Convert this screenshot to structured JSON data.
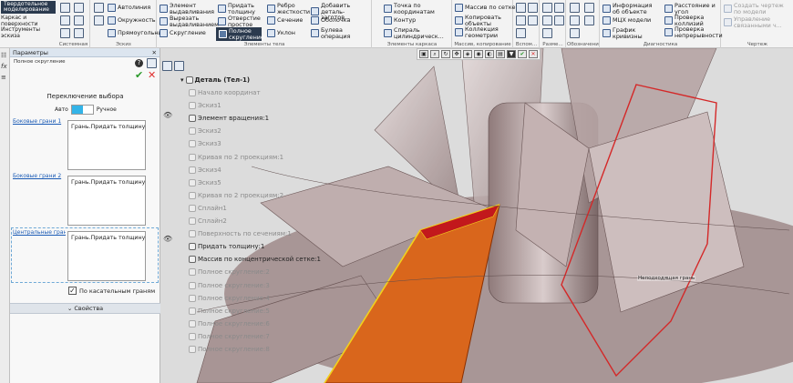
{
  "ribbon": {
    "tabs": [
      "Твердотельное моделирование",
      "Каркас и поверхности",
      "Инструменты эскиза"
    ],
    "groups": {
      "system": "Системная",
      "sketch": "Эскиз",
      "body_elements": "Элементы тела",
      "frame_elements": "Элементы каркаса",
      "mass_copy": "Массив, копирование",
      "aux": "Вспом...",
      "dim": "Разме...",
      "marks": "Обозначения",
      "diag": "Диагностика",
      "drawing": "Чертеж"
    },
    "buttons": {
      "autoline": "Автолиния",
      "circle": "Окружность",
      "rectangle": "Прямоугольник",
      "extrude": "Элемент выдавливания",
      "cut_extrude": "Вырезать выдавливанием",
      "fillet": "Скругление",
      "thicken": "Придать толщину",
      "hole": "Отверстие простое",
      "full_fillet": "Полное скругление",
      "rib": "Ребро жесткости",
      "section": "Сечение",
      "draft": "Уклон",
      "add_part": "Добавить деталь-заготов...",
      "shell": "Оболочка",
      "boolean": "Булева операция",
      "point_coord": "Точка по координатам",
      "contour": "Контур",
      "spiral": "Спираль цилиндрическ...",
      "pattern_grid": "Массив по сетке",
      "copy_objects": "Копировать объекты",
      "geom_collection": "Коллекция геометрии",
      "info": "Информация об объекте",
      "mcx": "МЦХ модели",
      "curvature": "График кривизны",
      "distance": "Расстояние и угол",
      "check_collisions": "Проверка коллизий",
      "check_continuity": "Проверка непрерывности",
      "create_view": "Создать чертеж по модели",
      "control": "Управление связанными ч..."
    }
  },
  "panel": {
    "title": "Параметры",
    "subtitle": "Полное скругление",
    "switch_title": "Переключение выбора",
    "auto_label": "Авто",
    "manual_label": "Ручное",
    "side_faces_1": "Боковые грани 1",
    "side_faces_1_value": "Грань.Придать толщину:1...",
    "side_faces_2": "Боковые грани 2",
    "side_faces_2_value": "Грань.Придать толщину:1...",
    "central_faces": "Центральные грани",
    "central_faces_value": "Грань.Придать толщину:1...",
    "tangent_checkbox": "По касательным граням",
    "properties": "Свойства"
  },
  "tree": {
    "root": "Деталь (Тел-1)",
    "items": [
      {
        "label": "Начало координат",
        "muted": true
      },
      {
        "label": "Эскиз1",
        "muted": true
      },
      {
        "label": "Элемент вращения:1",
        "muted": false
      },
      {
        "label": "Эскиз2",
        "muted": true
      },
      {
        "label": "Эскиз3",
        "muted": true
      },
      {
        "label": "Кривая по 2 проекциям:1",
        "muted": true
      },
      {
        "label": "Эскиз4",
        "muted": true
      },
      {
        "label": "Эскиз5",
        "muted": true
      },
      {
        "label": "Кривая по 2 проекциям:2",
        "muted": true
      },
      {
        "label": "Сплайн1",
        "muted": true
      },
      {
        "label": "Сплайн2",
        "muted": true
      },
      {
        "label": "Поверхность по сечениям:1",
        "muted": true
      },
      {
        "label": "Придать толщину:1",
        "muted": false
      },
      {
        "label": "Массив по концентрической сетке:1",
        "muted": false
      },
      {
        "label": "Полное скругление:2",
        "muted": true
      },
      {
        "label": "Полное скругление:3",
        "muted": true
      },
      {
        "label": "Полное скругление:4",
        "muted": true
      },
      {
        "label": "Полное скругление:5",
        "muted": true
      },
      {
        "label": "Полное скругление:6",
        "muted": true
      },
      {
        "label": "Полное скругление:7",
        "muted": true
      },
      {
        "label": "Полное скругление:8",
        "muted": true
      }
    ]
  },
  "viewport": {
    "tooltip": "Неподходящая грань"
  },
  "colors": {
    "accent": "#34b4e8",
    "selection_orange": "#d9661c",
    "selection_red": "#d42828",
    "selection_yellow": "#f2d21c"
  }
}
